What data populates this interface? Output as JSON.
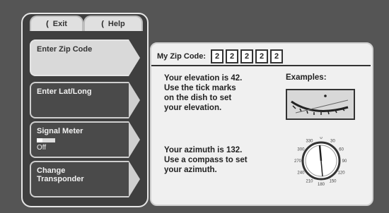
{
  "tabs": {
    "exit": {
      "label": "Exit",
      "icon": "swoosh-icon"
    },
    "help": {
      "label": "Help",
      "icon": "swoosh-icon"
    }
  },
  "menu": {
    "items": [
      {
        "label": "Enter Zip Code",
        "active": true
      },
      {
        "label": "Enter Lat/Long",
        "active": false
      },
      {
        "label": "Signal Meter",
        "active": false,
        "state": "Off",
        "level": 0.3
      },
      {
        "label_line1": "Change",
        "label_line2": "Transponder",
        "active": false
      }
    ]
  },
  "zip": {
    "label": "My Zip Code:",
    "digits": [
      "2",
      "2",
      "2",
      "2",
      "2"
    ]
  },
  "elevation": {
    "line1": "Your elevation is 42.",
    "line2": "Use the tick marks",
    "line3": "on the dish to set",
    "line4": "your elevation."
  },
  "azimuth": {
    "line1": "Your azimuth is 132.",
    "line2": "Use a compass to set",
    "line3": "your azimuth."
  },
  "examples": {
    "label": "Examples:"
  },
  "compass_labels": [
    "0",
    "30",
    "60",
    "90",
    "120",
    "150",
    "180",
    "210",
    "240",
    "270",
    "300",
    "330"
  ]
}
